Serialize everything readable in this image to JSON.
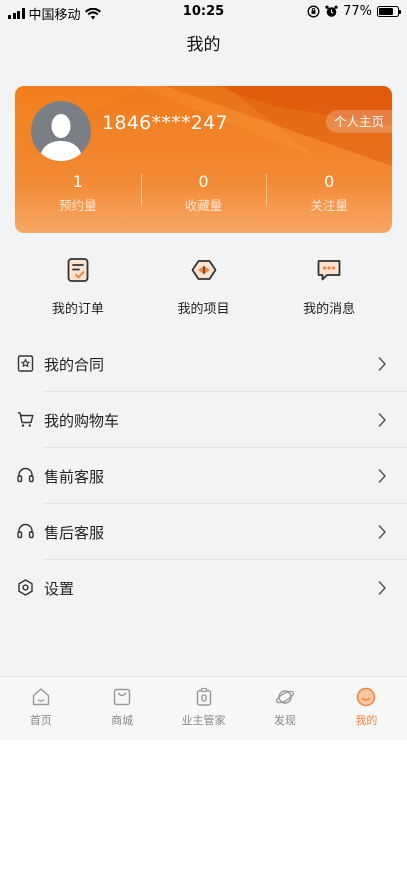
{
  "status_bar": {
    "carrier": "中国移动",
    "time": "10:25",
    "battery": "77%",
    "battery_level": 0.77
  },
  "header": {
    "title": "我的"
  },
  "profile": {
    "phone": "1846****247",
    "home_button": "个人主页",
    "stats": [
      {
        "value": "1",
        "label": "预约量"
      },
      {
        "value": "0",
        "label": "收藏量"
      },
      {
        "value": "0",
        "label": "关注量"
      }
    ]
  },
  "quick_actions": [
    {
      "label": "我的订单",
      "icon": "order-icon"
    },
    {
      "label": "我的项目",
      "icon": "project-icon"
    },
    {
      "label": "我的消息",
      "icon": "message-icon"
    }
  ],
  "menu": [
    {
      "label": "我的合同",
      "icon": "contract-icon"
    },
    {
      "label": "我的购物车",
      "icon": "cart-icon"
    },
    {
      "label": "售前客服",
      "icon": "headset-icon"
    },
    {
      "label": "售后客服",
      "icon": "headset-icon"
    },
    {
      "label": "设置",
      "icon": "settings-icon"
    }
  ],
  "tabs": [
    {
      "label": "首页",
      "icon": "home-icon"
    },
    {
      "label": "商城",
      "icon": "shop-icon"
    },
    {
      "label": "业主管家",
      "icon": "butler-icon"
    },
    {
      "label": "发现",
      "icon": "planet-icon"
    },
    {
      "label": "我的",
      "icon": "profile-icon",
      "active": true
    }
  ],
  "colors": {
    "accent": "#f0823a",
    "card_gradient_top": "#ef7a1a",
    "card_gradient_bottom": "#f7a866"
  }
}
